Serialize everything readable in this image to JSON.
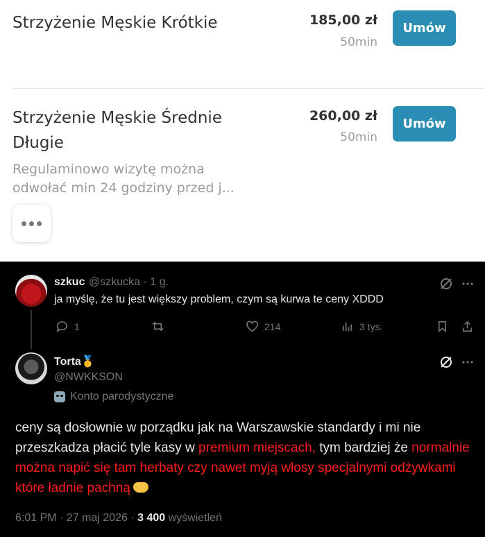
{
  "services": [
    {
      "name": "Strzyżenie Męskie Krótkie",
      "price": "185,00 zł",
      "duration": "50min",
      "button": "Umów"
    },
    {
      "name_line1": "Strzyżenie Męskie Średnie",
      "name_line2": "Długie",
      "price": "260,00 zł",
      "duration": "50min",
      "button": "Umów",
      "desc_line1": "Regulaminowo wizytę można",
      "desc_line2": "odwołać min 24 godziny przed j..."
    }
  ],
  "tweet1": {
    "name": "szkuc",
    "handle_time": "@szkucka · 1 g.",
    "text": "ja myślę, że tu jest większy problem, czym są kurwa te ceny XDDD",
    "replies": "1",
    "likes": "214",
    "views": "3 tys."
  },
  "tweet2": {
    "name": "Torta",
    "badge_emoji": "🥇",
    "handle": "@NWKKSON",
    "parody_label": "Konto parodystyczne",
    "text_part1": "ceny są dosłownie w porządku jak na Warszawskie standardy i mi nie przeszkadza płacić tyle kasy w ",
    "text_red": "premium miejscach,",
    "text_part2": " tym bardziej że ",
    "text_red2": "normalnie można napić się tam herbaty czy nawet myją włosy specjalnymi odżywkami które ładnie pachną",
    "time_date": "6:01 PM · 27 maj 2026 · ",
    "view_count": "3 400",
    "views_label": " wyświetleń"
  },
  "colors": {
    "book_button": "#2a8eb4",
    "highlight_red": "#ff1c1c",
    "dark_bg": "#000000"
  }
}
